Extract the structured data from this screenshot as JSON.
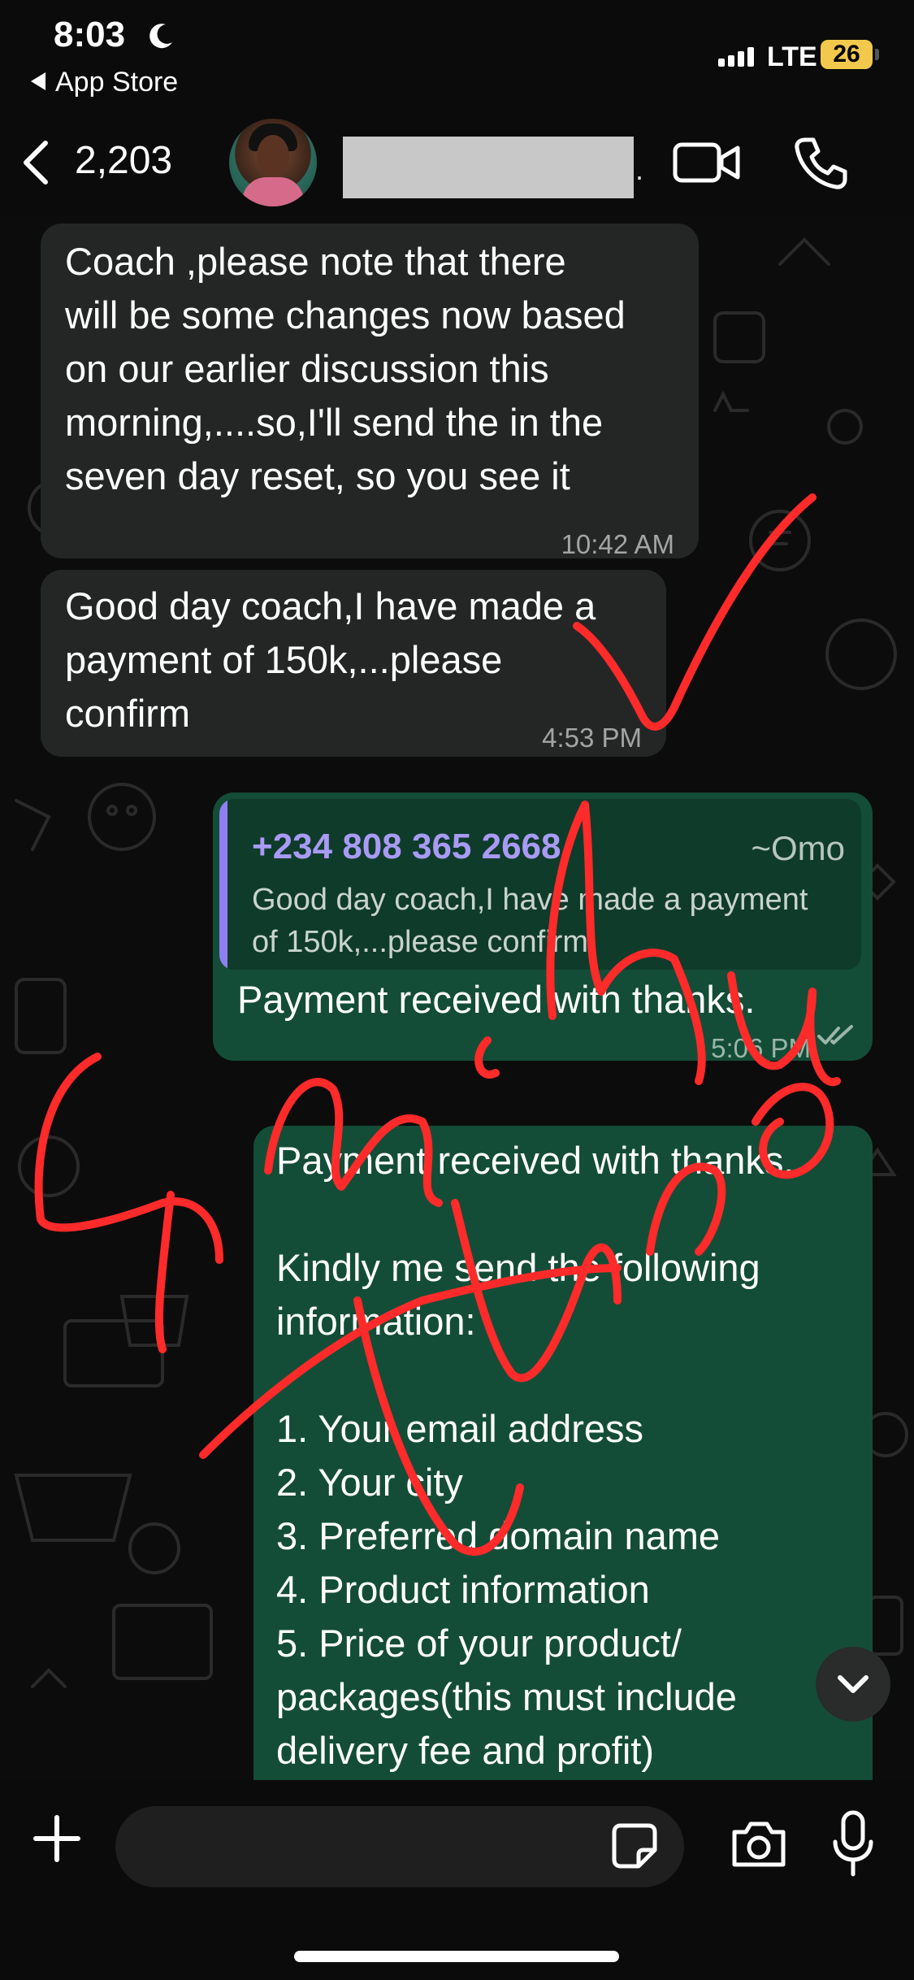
{
  "status_bar": {
    "time": "8:03",
    "back_app": "App Store",
    "network": "LTE",
    "battery": "26"
  },
  "header": {
    "unread_count": "2,203",
    "contact_name": ""
  },
  "messages": [
    {
      "direction": "incoming",
      "text": "Coach ,please note that there\nwill be some changes now based\non our earlier discussion this\nmorning,....so,I'll send the in the\nseven day reset, so you see it",
      "time": "10:42 AM"
    },
    {
      "direction": "incoming",
      "text": "Good day coach,I have made a\npayment of 150k,...please\nconfirm",
      "time": "4:53 PM"
    },
    {
      "direction": "outgoing",
      "quote_sender": "+234 808 365 2668",
      "quote_name": "~Omo",
      "quote_text": "Good day coach,I have made a payment\nof 150k,...please confirm",
      "text": "Payment received with thanks.",
      "time": "5:06 PM"
    },
    {
      "direction": "outgoing",
      "text": "Payment received with thanks.\n\nKindly me send the following\ninformation:\n\n1. Your email address\n2. Your city\n3. Preferred domain name\n4. Product information\n5. Price of your product/\n    packages(this must include\n    delivery fee and profit)"
    }
  ],
  "composer": {
    "placeholder": ""
  },
  "colors": {
    "incoming_bubble": "#242626",
    "outgoing_bubble": "#144d37",
    "quote_accent": "#8f7ff0",
    "annotation_ink": "#ff2a2a",
    "battery": "#f2c94c"
  },
  "icons": [
    "moon-icon",
    "signal-icon",
    "back-chevron-icon",
    "video-call-icon",
    "phone-call-icon",
    "chevron-down-icon",
    "plus-icon",
    "sticker-icon",
    "camera-icon",
    "microphone-icon",
    "double-check-icon"
  ]
}
